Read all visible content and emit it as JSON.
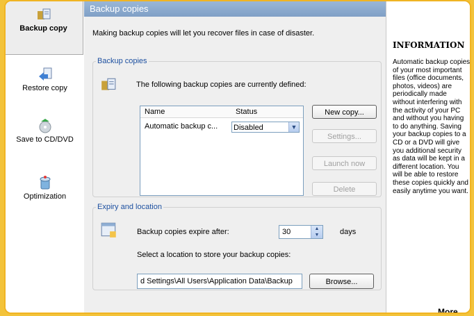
{
  "sidebar": {
    "items": [
      {
        "label": "Backup copy",
        "icon": "backup-copy-icon"
      },
      {
        "label": "Restore copy",
        "icon": "restore-copy-icon"
      },
      {
        "label": "Save to CD/DVD",
        "icon": "save-cd-icon"
      },
      {
        "label": "Optimization",
        "icon": "optimization-icon"
      }
    ]
  },
  "main": {
    "title": "Backup copies",
    "intro": "Making backup copies will let you recover files in case of disaster.",
    "backup_group": {
      "legend": "Backup copies",
      "description": "The following backup copies are currently defined:",
      "columns": [
        "Name",
        "Status"
      ],
      "rows": [
        {
          "name": "Automatic backup c...",
          "status": "Disabled"
        }
      ],
      "buttons": {
        "new": "New copy...",
        "settings": "Settings...",
        "launch": "Launch now",
        "delete": "Delete"
      }
    },
    "expiry_group": {
      "legend": "Expiry and location",
      "expire_label": "Backup copies expire after:",
      "expire_value": "30",
      "expire_unit": "days",
      "location_label": "Select a location to store your backup copies:",
      "location_value": "d Settings\\All Users\\Application Data\\Backup",
      "browse": "Browse..."
    }
  },
  "info": {
    "heading": "INFORMATION",
    "text": "Automatic backup copies of your most important files (office documents, photos, videos) are periodically made without interfering with the activity of your PC and without you having to do anything. Saving your backup copies to a CD or a DVD will give you additional security as data will be kept in a different location. You will be able to restore these copies quickly and easily anytime you want.",
    "more": "More..."
  },
  "colors": {
    "accent": "#f0b423",
    "title_bar": "#8eaed3",
    "legend": "#1d50a0"
  }
}
